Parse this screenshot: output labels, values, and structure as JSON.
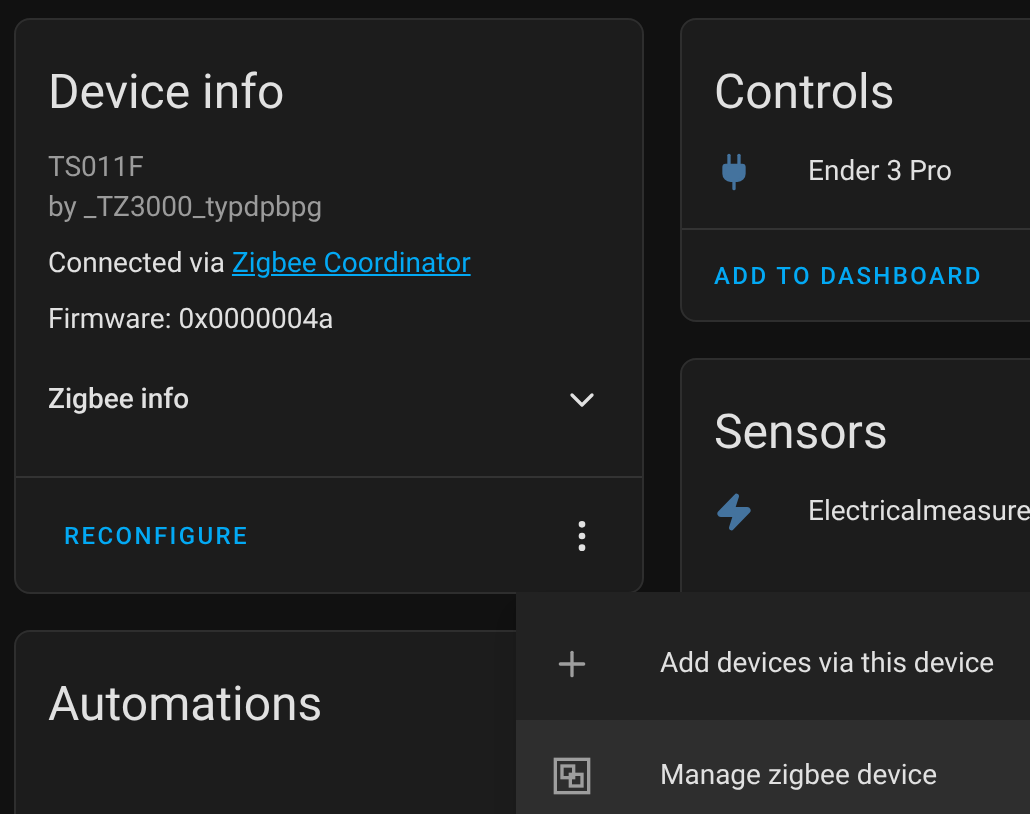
{
  "device_info": {
    "title": "Device info",
    "model": "TS011F",
    "manufacturer": "by _TZ3000_typdpbpg",
    "connected_prefix": "Connected via ",
    "connected_link": "Zigbee Coordinator",
    "firmware": "Firmware: 0x0000004a",
    "zigbee_info": {
      "label": "Zigbee info",
      "expanded": false
    },
    "action": "RECONFIGURE"
  },
  "automations": {
    "title": "Automations"
  },
  "controls": {
    "title": "Controls",
    "entities": [
      {
        "kind": "plug",
        "name": "Ender 3 Pro"
      }
    ],
    "action": "ADD TO DASHBOARD"
  },
  "sensors": {
    "title": "Sensors",
    "entities": [
      {
        "kind": "flash",
        "name": "Electricalmeasure"
      }
    ]
  },
  "menu": {
    "items": [
      {
        "kind": "plus",
        "label": "Add devices via this device",
        "highlighted": false
      },
      {
        "kind": "manage",
        "label": "Manage zigbee device",
        "highlighted": true
      }
    ]
  }
}
